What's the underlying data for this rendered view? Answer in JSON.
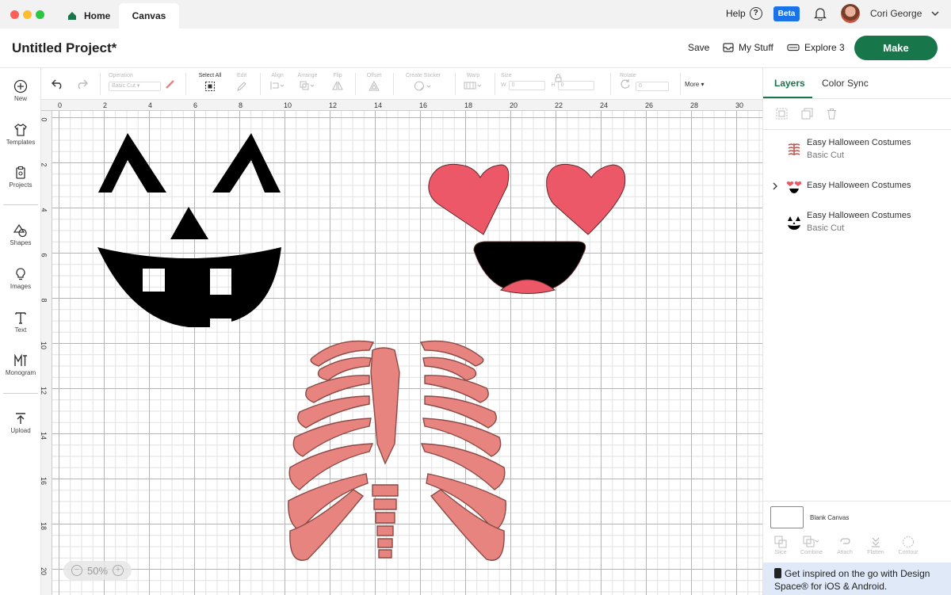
{
  "colors": {
    "accent": "#18764b",
    "beta": "#1a73e8",
    "heart": "#ec5868",
    "skeleton": "#e8847f",
    "skeleton_stroke": "#8b4a45"
  },
  "titlebar": {
    "tabs": [
      {
        "label": "Home",
        "icon": "home-icon"
      },
      {
        "label": "Canvas"
      }
    ],
    "help_label": "Help",
    "beta_label": "Beta",
    "user_name": "Cori George"
  },
  "header": {
    "project_title": "Untitled Project*",
    "save_label": "Save",
    "my_stuff_label": "My Stuff",
    "machine_label": "Explore 3",
    "make_label": "Make"
  },
  "sidebar": {
    "items": [
      {
        "label": "New",
        "icon": "plus-circle-icon"
      },
      {
        "label": "Templates",
        "icon": "tshirt-icon"
      },
      {
        "label": "Projects",
        "icon": "projects-icon"
      },
      {
        "label": "Shapes",
        "icon": "shapes-icon"
      },
      {
        "label": "Images",
        "icon": "lightbulb-icon"
      },
      {
        "label": "Text",
        "icon": "text-icon"
      },
      {
        "label": "Monogram",
        "icon": "monogram-icon"
      },
      {
        "label": "Upload",
        "icon": "upload-icon"
      }
    ]
  },
  "toolbar": {
    "operation_label": "Operation",
    "operation_value": "Basic Cut",
    "select_all_label": "Select All",
    "edit_label": "Edit",
    "align_label": "Align",
    "arrange_label": "Arrange",
    "flip_label": "Flip",
    "offset_label": "Offset",
    "create_sticker_label": "Create Sticker",
    "warp_label": "Warp",
    "size_label": "Size",
    "size_w_label": "W",
    "size_w_value": "0",
    "size_h_label": "H",
    "size_h_value": "0",
    "rotate_label": "Rotate",
    "rotate_value": "0",
    "more_label": "More"
  },
  "rulers": {
    "top": [
      "0",
      "2",
      "4",
      "6",
      "8",
      "10",
      "12",
      "14",
      "16",
      "18",
      "20",
      "22",
      "24",
      "26",
      "28",
      "30"
    ],
    "left": [
      "0",
      "2",
      "4",
      "6",
      "8",
      "10",
      "12",
      "14",
      "16",
      "18",
      "20"
    ]
  },
  "canvas": {
    "zoom_level": "50%"
  },
  "right_panel": {
    "tabs": [
      "Layers",
      "Color Sync"
    ],
    "layers": [
      {
        "name": "Easy Halloween Costumes",
        "sub": "Basic Cut",
        "icon": "ribcage-thumb-icon"
      },
      {
        "name": "Easy Halloween Costumes",
        "sub": "",
        "icon": "heart-face-thumb-icon",
        "expandable": true
      },
      {
        "name": "Easy Halloween Costumes",
        "sub": "Basic Cut",
        "icon": "pumpkin-face-thumb-icon"
      }
    ],
    "blank_canvas_label": "Blank Canvas",
    "actions": [
      "Slice",
      "Combine",
      "Attach",
      "Flatten",
      "Contour"
    ],
    "promo_text": "Get inspired on the go with Design Space® for iOS & Android."
  }
}
